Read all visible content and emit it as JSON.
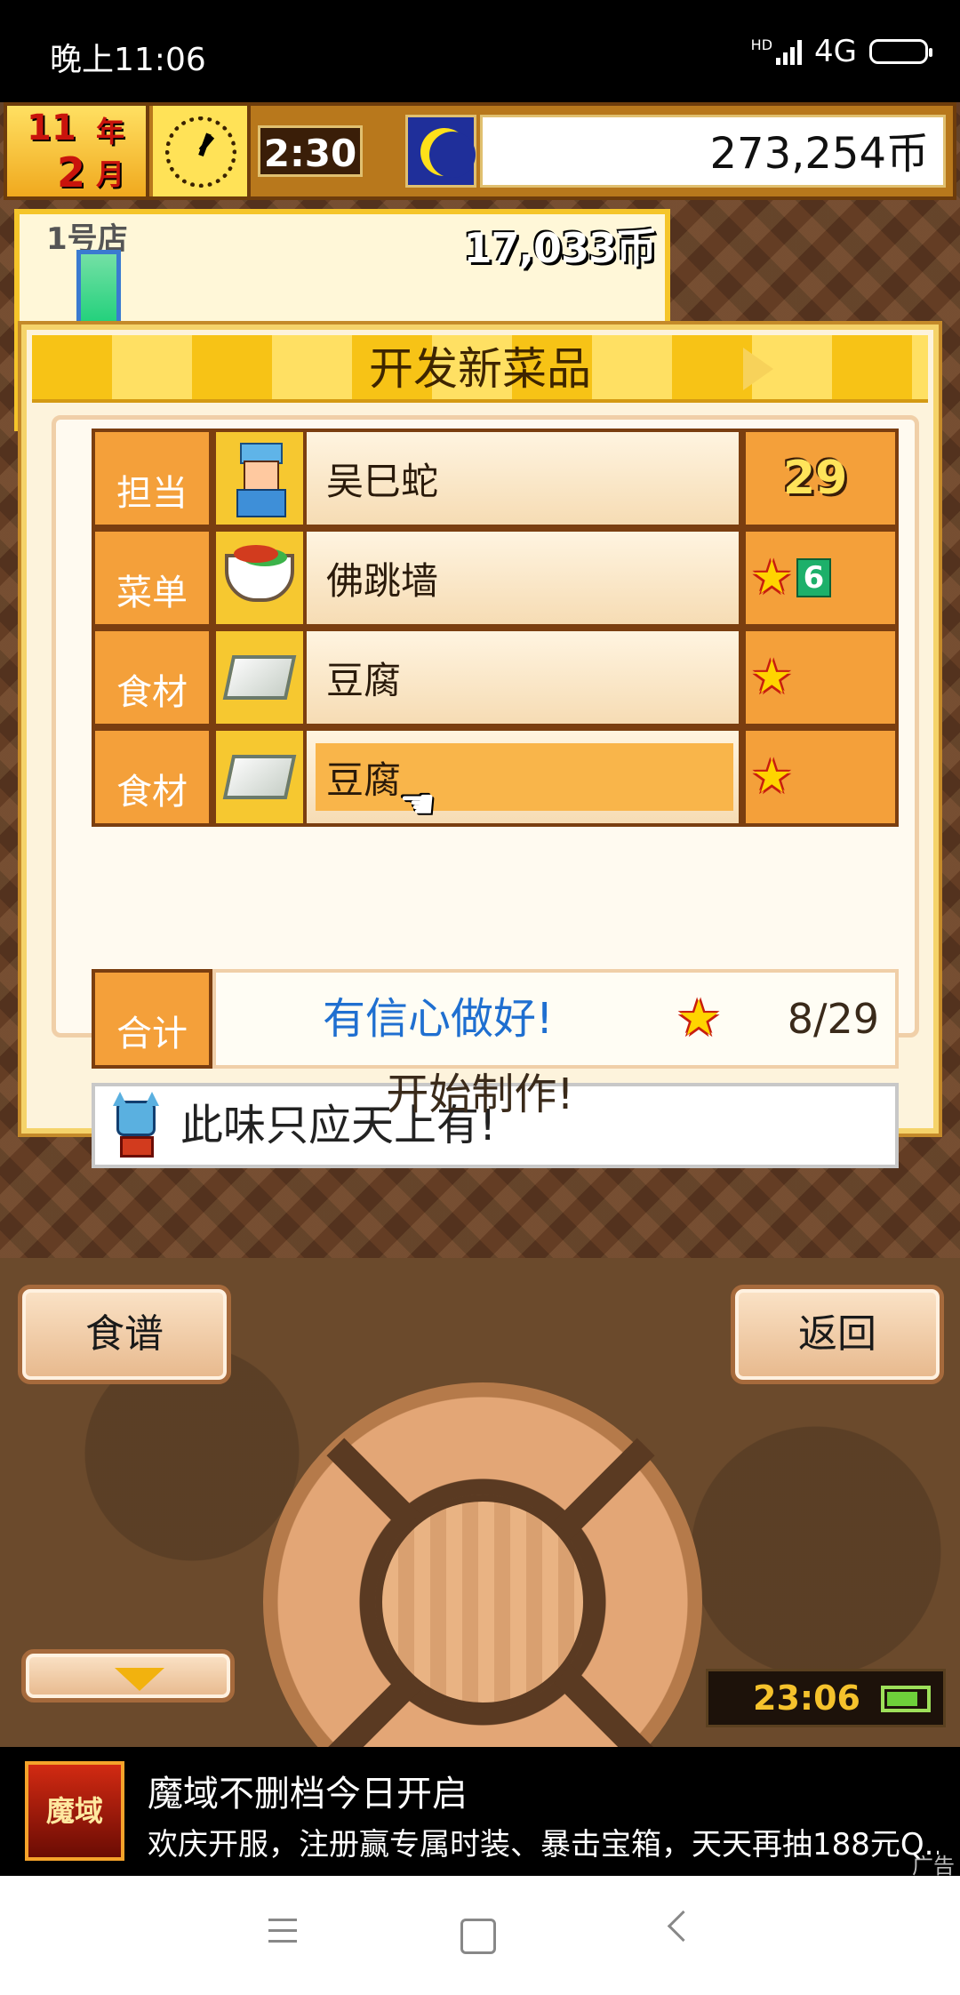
{
  "status_bar": {
    "time": "晚上11:06",
    "network": "4G",
    "hd": "HD"
  },
  "topbar": {
    "year": "11",
    "year_unit": "年",
    "month": "2",
    "month_unit": "月",
    "game_time": "2:30",
    "money": "273,254币"
  },
  "shop": {
    "name": "1号店",
    "money": "17,033币"
  },
  "dialog": {
    "title": "开发新菜品",
    "rows": [
      {
        "label": "担当",
        "value": "吴巳蛇",
        "icon": "chef-icon",
        "num": "29"
      },
      {
        "label": "菜单",
        "value": "佛跳墙",
        "icon": "dish-bowl-icon",
        "stars": 1,
        "badge": "6"
      },
      {
        "label": "食材",
        "value": "豆腐",
        "icon": "tofu-icon",
        "stars": 1
      },
      {
        "label": "食材",
        "value": "豆腐",
        "icon": "tofu-icon",
        "stars": 1
      }
    ],
    "total_label": "合计",
    "total_message": "有信心做好!",
    "total_score": "8/29",
    "comment": "此味只应天上有!",
    "start_label": "开始制作!"
  },
  "controls": {
    "recipe_label": "食谱",
    "back_label": "返回",
    "clock": "23:06"
  },
  "ad": {
    "icon_text": "魔域",
    "title": "魔域不删档今日开启",
    "description": "欢庆开服，注册赢专属时装、暴击宝箱，天天再抽188元Q...",
    "tag": "广告"
  },
  "colors": {
    "accent": "#f4a03a",
    "title_bar": "#f7c316",
    "message_blue": "#1f6fd0"
  }
}
